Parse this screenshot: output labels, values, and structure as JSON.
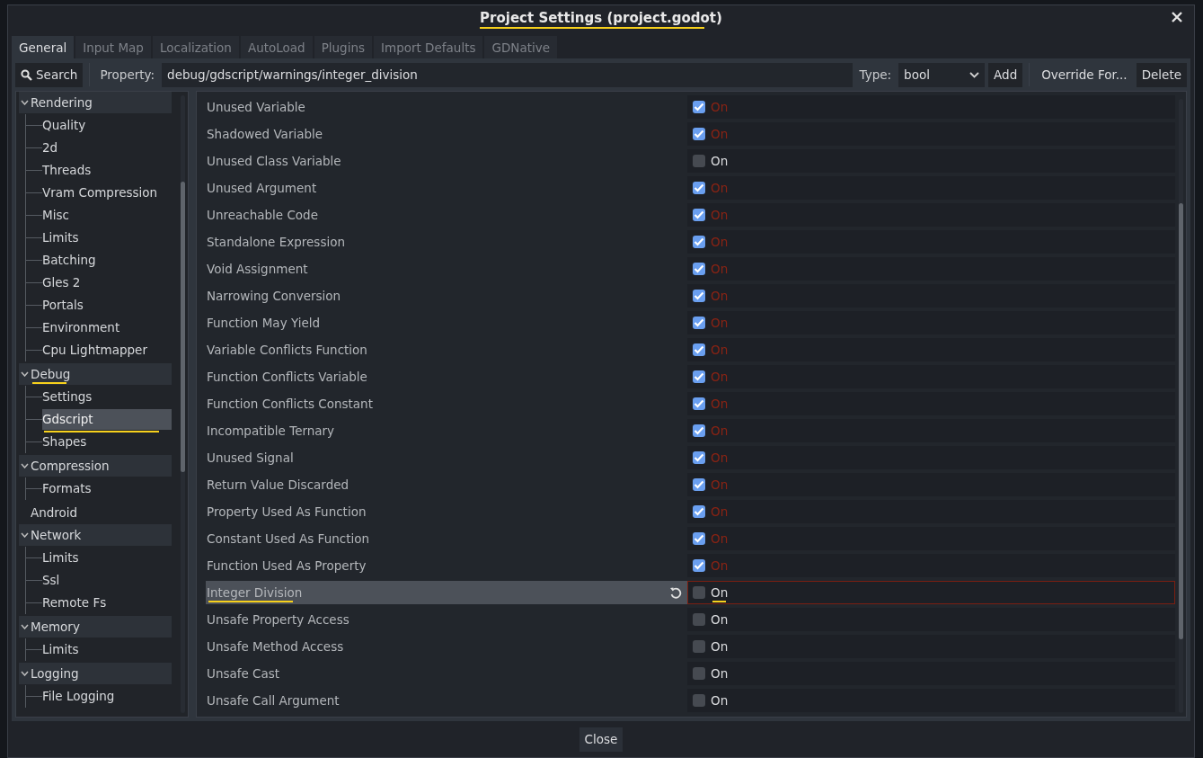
{
  "window": {
    "title": "Project Settings (project.godot)",
    "title_marked": true
  },
  "tabs": [
    {
      "label": "General",
      "selected": true
    },
    {
      "label": "Input Map",
      "selected": false
    },
    {
      "label": "Localization",
      "selected": false
    },
    {
      "label": "AutoLoad",
      "selected": false
    },
    {
      "label": "Plugins",
      "selected": false
    },
    {
      "label": "Import Defaults",
      "selected": false
    },
    {
      "label": "GDNative",
      "selected": false
    }
  ],
  "toolbar": {
    "search_button": "Search",
    "property_label": "Property:",
    "property_value": "debug/gdscript/warnings/integer_division",
    "type_label": "Type:",
    "type_value": "bool",
    "add_button": "Add",
    "override_button": "Override For...",
    "delete_button": "Delete"
  },
  "tree": [
    {
      "label": "Rendering",
      "expanded": true,
      "children": [
        {
          "label": "Quality",
          "selected": false,
          "marked": false
        },
        {
          "label": "2d",
          "selected": false,
          "marked": false
        },
        {
          "label": "Threads",
          "selected": false,
          "marked": false
        },
        {
          "label": "Vram Compression",
          "selected": false,
          "marked": false
        },
        {
          "label": "Misc",
          "selected": false,
          "marked": false
        },
        {
          "label": "Limits",
          "selected": false,
          "marked": false
        },
        {
          "label": "Batching",
          "selected": false,
          "marked": false
        },
        {
          "label": "Gles 2",
          "selected": false,
          "marked": false
        },
        {
          "label": "Portals",
          "selected": false,
          "marked": false
        },
        {
          "label": "Environment",
          "selected": false,
          "marked": false
        },
        {
          "label": "Cpu Lightmapper",
          "selected": false,
          "marked": false
        }
      ]
    },
    {
      "label": "Debug",
      "expanded": true,
      "marked": true,
      "children": [
        {
          "label": "Settings",
          "selected": false,
          "marked": false
        },
        {
          "label": "Gdscript",
          "selected": true,
          "marked": true
        },
        {
          "label": "Shapes",
          "selected": false,
          "marked": false
        }
      ]
    },
    {
      "label": "Compression",
      "expanded": true,
      "children": [
        {
          "label": "Formats",
          "selected": false,
          "marked": false
        }
      ]
    },
    {
      "label": "Android"
    },
    {
      "label": "Network",
      "expanded": true,
      "children": [
        {
          "label": "Limits",
          "selected": false,
          "marked": false
        },
        {
          "label": "Ssl",
          "selected": false,
          "marked": false
        },
        {
          "label": "Remote Fs",
          "selected": false,
          "marked": false
        }
      ]
    },
    {
      "label": "Memory",
      "expanded": true,
      "children": [
        {
          "label": "Limits",
          "selected": false,
          "marked": false
        }
      ]
    },
    {
      "label": "Logging",
      "expanded": true,
      "children": [
        {
          "label": "File Logging",
          "selected": false,
          "marked": false
        }
      ]
    }
  ],
  "properties": [
    {
      "name": "Unused Variable",
      "checked": true,
      "value": "On",
      "selected": false
    },
    {
      "name": "Shadowed Variable",
      "checked": true,
      "value": "On",
      "selected": false
    },
    {
      "name": "Unused Class Variable",
      "checked": false,
      "value": "On",
      "selected": false
    },
    {
      "name": "Unused Argument",
      "checked": true,
      "value": "On",
      "selected": false
    },
    {
      "name": "Unreachable Code",
      "checked": true,
      "value": "On",
      "selected": false
    },
    {
      "name": "Standalone Expression",
      "checked": true,
      "value": "On",
      "selected": false
    },
    {
      "name": "Void Assignment",
      "checked": true,
      "value": "On",
      "selected": false
    },
    {
      "name": "Narrowing Conversion",
      "checked": true,
      "value": "On",
      "selected": false
    },
    {
      "name": "Function May Yield",
      "checked": true,
      "value": "On",
      "selected": false
    },
    {
      "name": "Variable Conflicts Function",
      "checked": true,
      "value": "On",
      "selected": false
    },
    {
      "name": "Function Conflicts Variable",
      "checked": true,
      "value": "On",
      "selected": false
    },
    {
      "name": "Function Conflicts Constant",
      "checked": true,
      "value": "On",
      "selected": false
    },
    {
      "name": "Incompatible Ternary",
      "checked": true,
      "value": "On",
      "selected": false
    },
    {
      "name": "Unused Signal",
      "checked": true,
      "value": "On",
      "selected": false
    },
    {
      "name": "Return Value Discarded",
      "checked": true,
      "value": "On",
      "selected": false
    },
    {
      "name": "Property Used As Function",
      "checked": true,
      "value": "On",
      "selected": false
    },
    {
      "name": "Constant Used As Function",
      "checked": true,
      "value": "On",
      "selected": false
    },
    {
      "name": "Function Used As Property",
      "checked": true,
      "value": "On",
      "selected": false
    },
    {
      "name": "Integer Division",
      "checked": false,
      "value": "On",
      "selected": true,
      "marked": true
    },
    {
      "name": "Unsafe Property Access",
      "checked": false,
      "value": "On",
      "selected": false
    },
    {
      "name": "Unsafe Method Access",
      "checked": false,
      "value": "On",
      "selected": false
    },
    {
      "name": "Unsafe Cast",
      "checked": false,
      "value": "On",
      "selected": false
    },
    {
      "name": "Unsafe Call Argument",
      "checked": false,
      "value": "On",
      "selected": false
    }
  ],
  "close_button": "Close"
}
